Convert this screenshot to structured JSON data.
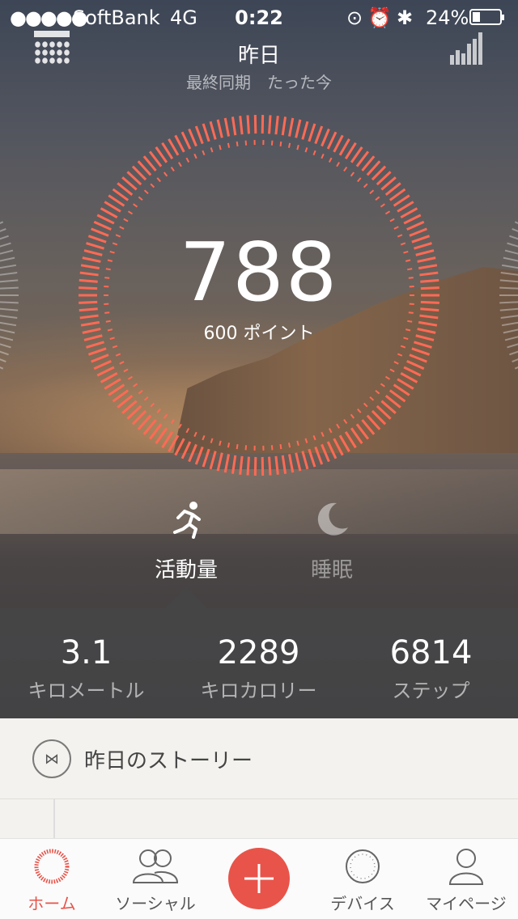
{
  "status_bar": {
    "signal": "●●●●●",
    "carrier": "SoftBank",
    "network": "4G",
    "time": "0:22",
    "status_icons": "⊙⏰✱",
    "battery_percent": "24%",
    "battery_level": 0.24
  },
  "header": {
    "title": "昨日",
    "subtitle": "最終同期　たった今"
  },
  "score": {
    "value": "788",
    "goal_text": "600 ポイント",
    "ring_color": "#ff6a55"
  },
  "modes": {
    "activity_label": "活動量",
    "sleep_label": "睡眠"
  },
  "stats": [
    {
      "value": "3.1",
      "label": "キロメートル"
    },
    {
      "value": "2289",
      "label": "キロカロリー"
    },
    {
      "value": "6814",
      "label": "ステップ"
    }
  ],
  "story": {
    "title": "昨日のストーリー",
    "badge_icon": "bowtie-icon"
  },
  "tabs": [
    {
      "label": "ホーム",
      "icon": "home-ring-icon",
      "active": true
    },
    {
      "label": "ソーシャル",
      "icon": "people-icon"
    },
    {
      "label": "",
      "icon": "plus-icon"
    },
    {
      "label": "デバイス",
      "icon": "device-icon"
    },
    {
      "label": "マイページ",
      "icon": "person-icon"
    }
  ],
  "colors": {
    "accent": "#e8544a",
    "ring": "#ff6a55"
  }
}
